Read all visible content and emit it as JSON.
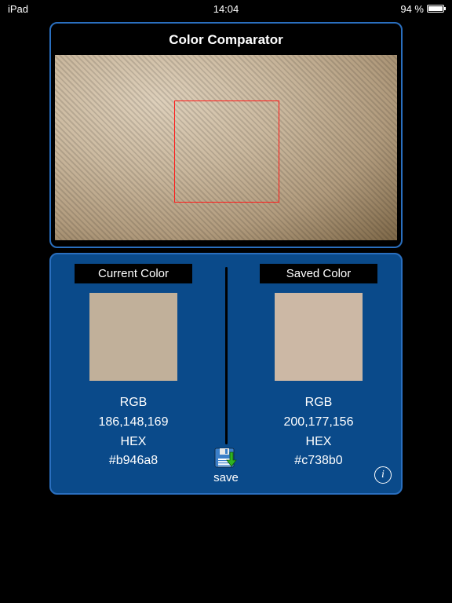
{
  "status": {
    "device": "iPad",
    "time": "14:04",
    "battery": "94 %"
  },
  "header": {
    "title": "Color Comparator"
  },
  "comparison": {
    "current": {
      "label": "Current Color",
      "swatch": "#c1b09a",
      "rgb_label": "RGB",
      "rgb_value": "186,148,169",
      "hex_label": "HEX",
      "hex_value": "#b946a8"
    },
    "saved": {
      "label": "Saved Color",
      "swatch": "#ccb8a5",
      "rgb_label": "RGB",
      "rgb_value": "200,177,156",
      "hex_label": "HEX",
      "hex_value": "#c738b0"
    }
  },
  "actions": {
    "save": "save"
  },
  "colors": {
    "panel_border": "#2a6fbf",
    "panel_bg": "#0a4a8a",
    "reticle": "#ff1a1a"
  }
}
